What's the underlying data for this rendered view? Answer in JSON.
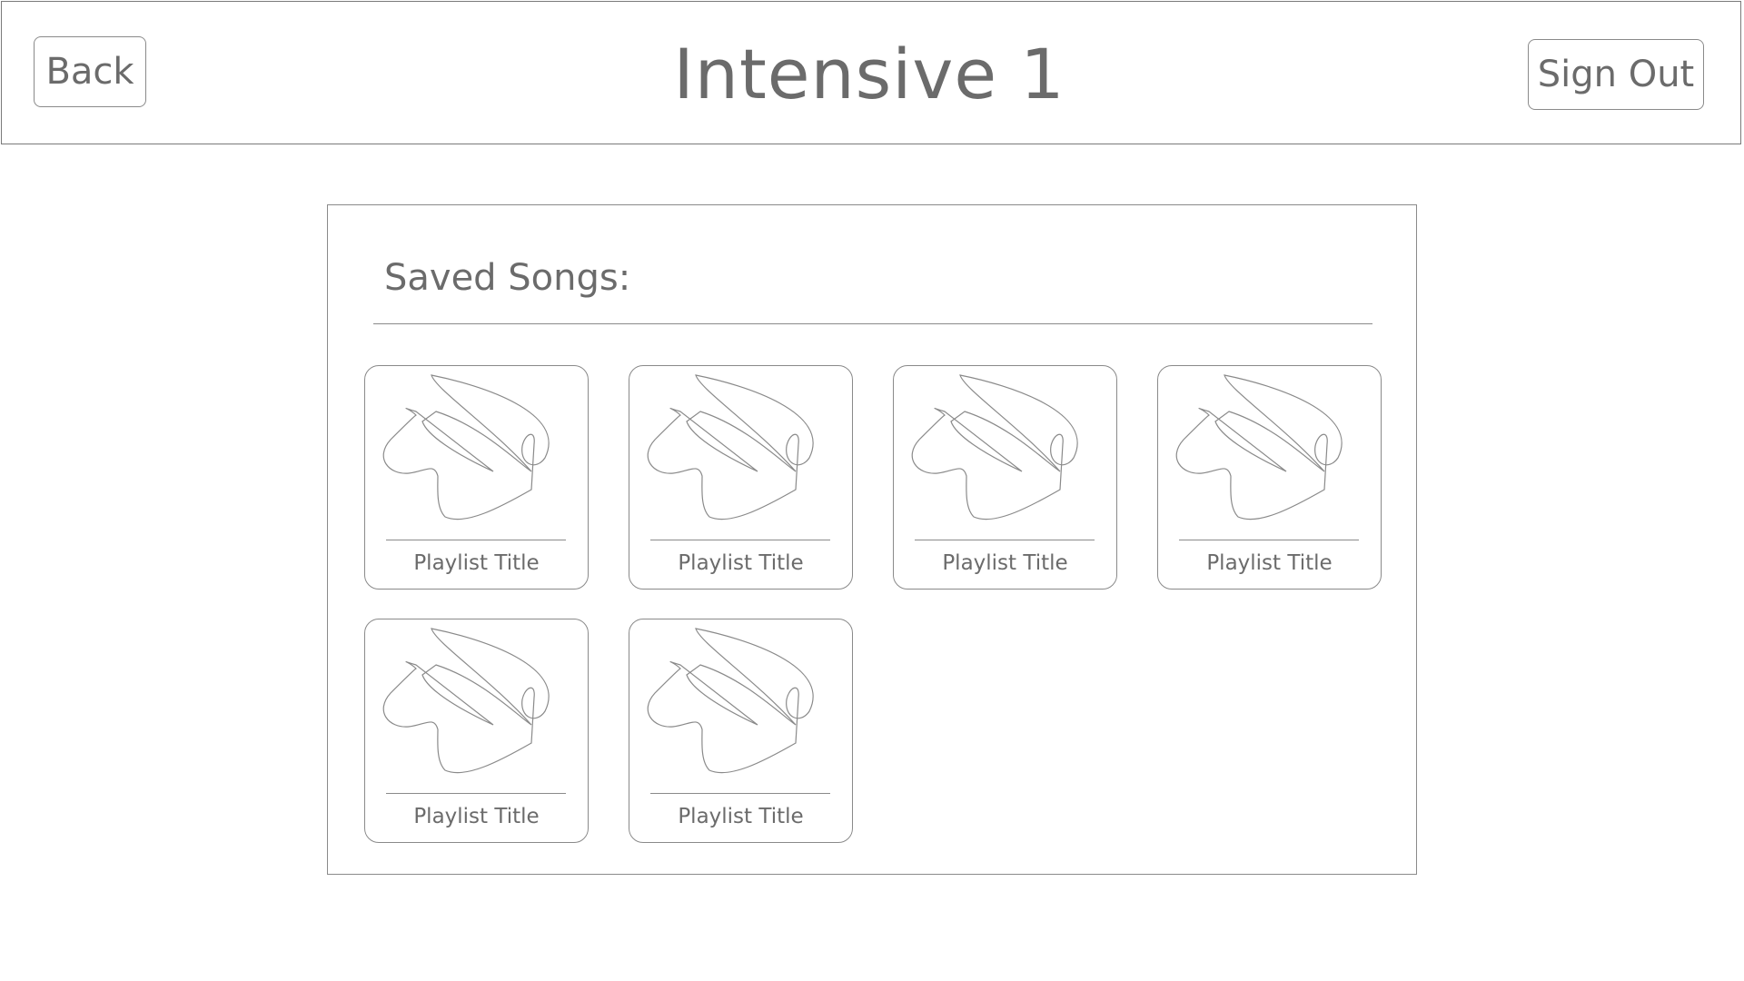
{
  "header": {
    "back_label": "Back",
    "title": "Intensive 1",
    "signout_label": "Sign Out"
  },
  "saved": {
    "heading": "Saved Songs:",
    "playlists": [
      {
        "title": "Playlist Title",
        "icon": "scribble-image-icon"
      },
      {
        "title": "Playlist Title",
        "icon": "scribble-image-icon"
      },
      {
        "title": "Playlist Title",
        "icon": "scribble-image-icon"
      },
      {
        "title": "Playlist Title",
        "icon": "scribble-image-icon"
      },
      {
        "title": "Playlist Title",
        "icon": "scribble-image-icon"
      },
      {
        "title": "Playlist Title",
        "icon": "scribble-image-icon"
      }
    ]
  },
  "colors": {
    "text": "#6b6b6b",
    "border": "#8a8a8a",
    "background": "#ffffff"
  }
}
